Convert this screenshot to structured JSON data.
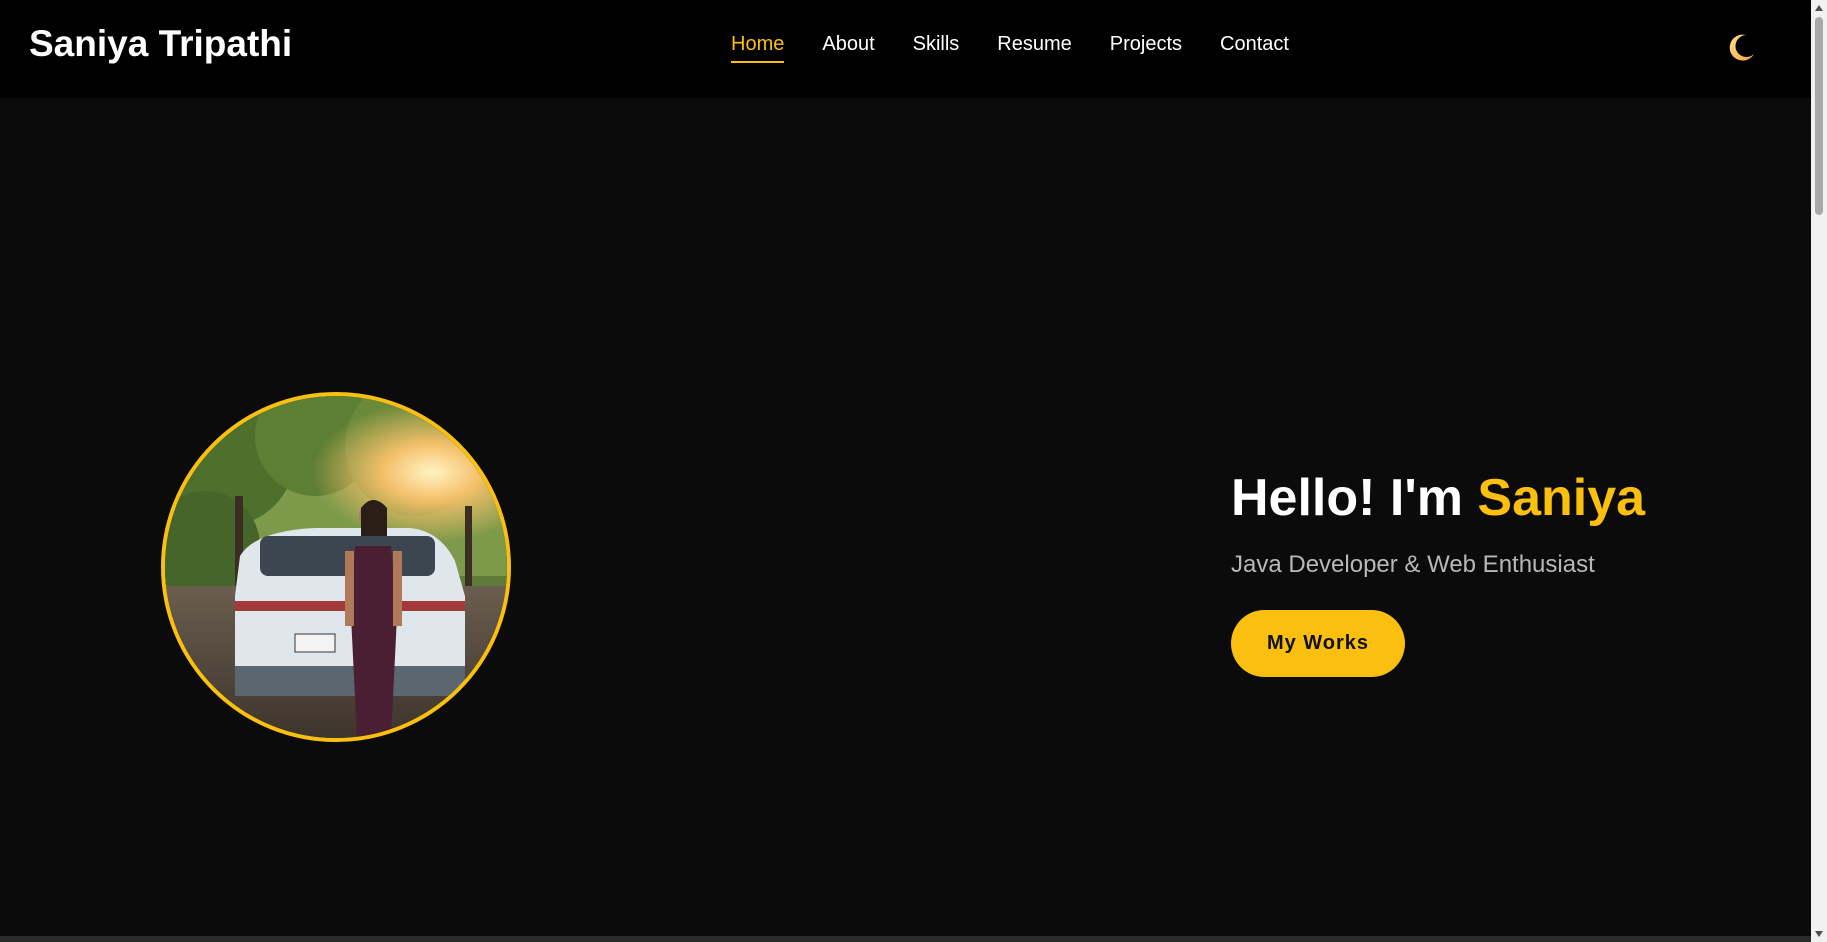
{
  "header": {
    "brand": "Saniya Tripathi",
    "nav": [
      {
        "label": "Home",
        "active": true
      },
      {
        "label": "About",
        "active": false
      },
      {
        "label": "Skills",
        "active": false
      },
      {
        "label": "Resume",
        "active": false
      },
      {
        "label": "Projects",
        "active": false
      },
      {
        "label": "Contact",
        "active": false
      }
    ],
    "theme_toggle_icon": "moon-icon"
  },
  "hero": {
    "greeting": "Hello! I'm ",
    "name": "Saniya",
    "subtitle": "Java Developer & Web Enthusiast",
    "cta_label": "My Works",
    "avatar_icon": "profile-photo"
  },
  "colors": {
    "accent": "#fbbf0f",
    "background": "#0b0b0b",
    "navbar": "#000000",
    "text": "#ffffff",
    "muted_text": "#b8b8b8"
  }
}
